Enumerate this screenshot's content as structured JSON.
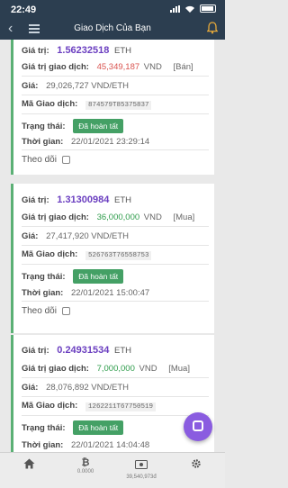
{
  "status_bar": {
    "time": "22:49"
  },
  "nav": {
    "title": "Giao Dịch Của Bạn"
  },
  "labels": {
    "value": "Giá trị:",
    "trade_value": "Giá trị giao dịch:",
    "price": "Giá:",
    "code": "Mã Giao dịch:",
    "status": "Trạng thái:",
    "time": "Thời gian:",
    "follow": "Theo dõi"
  },
  "cards": [
    {
      "value": "1.56232518",
      "unit": "ETH",
      "trade_value": "45,349,187",
      "trade_unit": "VND",
      "type": "[Bán]",
      "price": "29,026,727 VND/ETH",
      "code": "874579T85375837",
      "status": "Đã hoàn tất",
      "time": "22/01/2021 23:29:14"
    },
    {
      "value": "1.31300984",
      "unit": "ETH",
      "trade_value": "36,000,000",
      "trade_unit": "VND",
      "type": "[Mua]",
      "price": "27,417,920 VND/ETH",
      "code": "526763T76558753",
      "status": "Đã hoàn tất",
      "time": "22/01/2021 15:00:47"
    },
    {
      "value": "0.24931534",
      "unit": "ETH",
      "trade_value": "7,000,000",
      "trade_unit": "VND",
      "type": "[Mua]",
      "price": "28,076,892 VND/ETH",
      "code": "1262211T67750519",
      "status": "Đã hoàn tất",
      "time": "22/01/2021 14:04:48"
    }
  ],
  "tabbar": {
    "bitcoin_value": "0.0000",
    "wallet_value": "39,540,973đ"
  },
  "colors": {
    "accent_green": "#44a065",
    "nav_bg": "#2c3e50",
    "value_purple": "#6b3fc0",
    "sell_red": "#d9534f"
  }
}
